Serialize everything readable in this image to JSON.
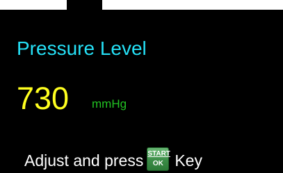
{
  "screen": {
    "title": "Pressure Level",
    "value": "730",
    "unit": "mmHg",
    "instruction": {
      "before": "Adjust and press",
      "after": "Key"
    },
    "key_icon": {
      "name": "start-ok-key-icon",
      "top_label": "START",
      "bottom_label": "OK"
    }
  },
  "colors": {
    "background": "#000000",
    "title": "#25e0f6",
    "value": "#ffff1f",
    "unit": "#22c423",
    "instruction": "#ffffff",
    "key": "#3b8c47"
  }
}
